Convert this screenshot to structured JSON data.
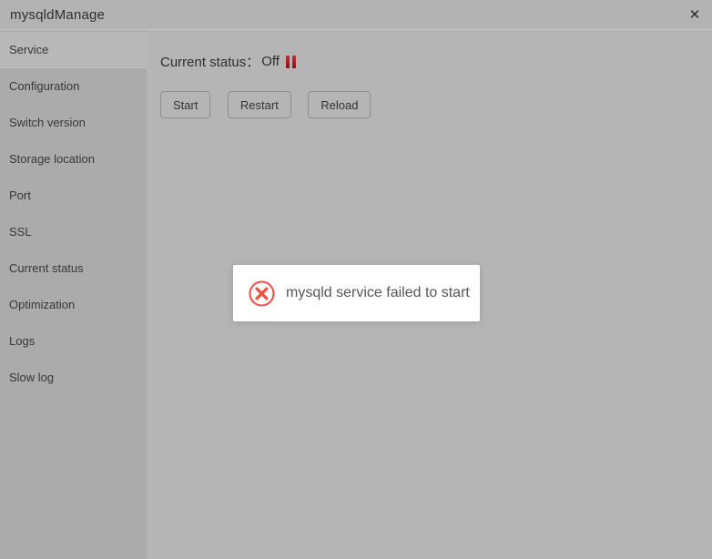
{
  "window": {
    "title": "mysqldManage",
    "close_glyph": "✕"
  },
  "sidebar": {
    "items": [
      {
        "label": "Service",
        "selected": true
      },
      {
        "label": "Configuration",
        "selected": false
      },
      {
        "label": "Switch version",
        "selected": false
      },
      {
        "label": "Storage location",
        "selected": false
      },
      {
        "label": "Port",
        "selected": false
      },
      {
        "label": "SSL",
        "selected": false
      },
      {
        "label": "Current status",
        "selected": false
      },
      {
        "label": "Optimization",
        "selected": false
      },
      {
        "label": "Logs",
        "selected": false
      },
      {
        "label": "Slow log",
        "selected": false
      }
    ]
  },
  "main": {
    "status_label": "Current status：",
    "status_value": "Off",
    "status_icon": "pause-icon",
    "buttons": [
      {
        "label": "Start"
      },
      {
        "label": "Restart"
      },
      {
        "label": "Reload"
      }
    ]
  },
  "toast": {
    "icon": "error-circle-x-icon",
    "message": "mysqld service failed to start"
  },
  "colors": {
    "titlebar_bg": "#b3b3b3",
    "sidebar_bg": "#ababab",
    "selected_item_bg": "#b8b8b8",
    "content_bg": "#b5b5b5",
    "status_red": "#b81414",
    "error_icon_red": "#f15049",
    "toast_bg": "#ffffff"
  }
}
